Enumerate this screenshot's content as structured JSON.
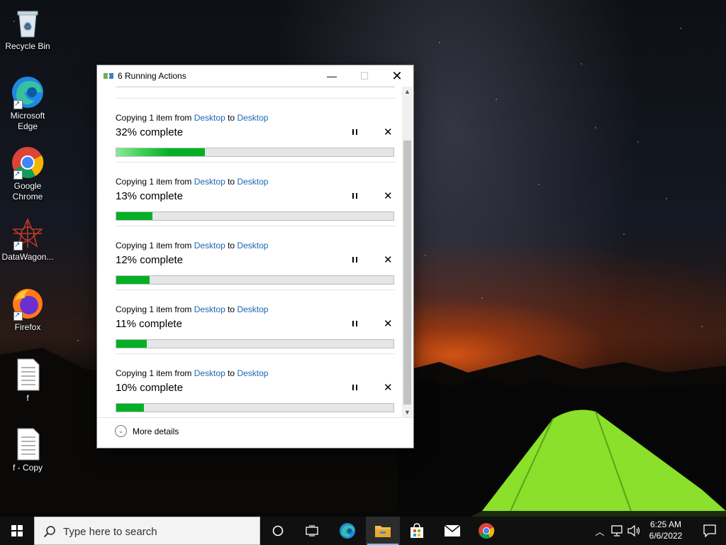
{
  "desktop": {
    "icons": [
      {
        "label": "Recycle Bin"
      },
      {
        "label": "Microsoft Edge"
      },
      {
        "label": "Google Chrome"
      },
      {
        "label": "DataWagon..."
      },
      {
        "label": "Firefox"
      },
      {
        "label": "f"
      },
      {
        "label": "f - Copy"
      }
    ]
  },
  "dialog": {
    "title": "6 Running Actions",
    "operations": [
      {
        "prefix": "Copying 1 item from ",
        "from": "Desktop",
        "mid": " to ",
        "to": "Desktop",
        "status": "32% complete",
        "progress_percent": 32
      },
      {
        "prefix": "Copying 1 item from ",
        "from": "Desktop",
        "mid": " to ",
        "to": "Desktop",
        "status": "13% complete",
        "progress_percent": 13
      },
      {
        "prefix": "Copying 1 item from ",
        "from": "Desktop",
        "mid": " to ",
        "to": "Desktop",
        "status": "12% complete",
        "progress_percent": 12
      },
      {
        "prefix": "Copying 1 item from ",
        "from": "Desktop",
        "mid": " to ",
        "to": "Desktop",
        "status": "11% complete",
        "progress_percent": 11
      },
      {
        "prefix": "Copying 1 item from ",
        "from": "Desktop",
        "mid": " to ",
        "to": "Desktop",
        "status": "10% complete",
        "progress_percent": 10
      }
    ],
    "more_details": "More details",
    "colors": {
      "progress": "#06b025",
      "link": "#1a66b5"
    }
  },
  "taskbar": {
    "search_placeholder": "Type here to search",
    "time": "6:25 AM",
    "date": "6/6/2022"
  }
}
